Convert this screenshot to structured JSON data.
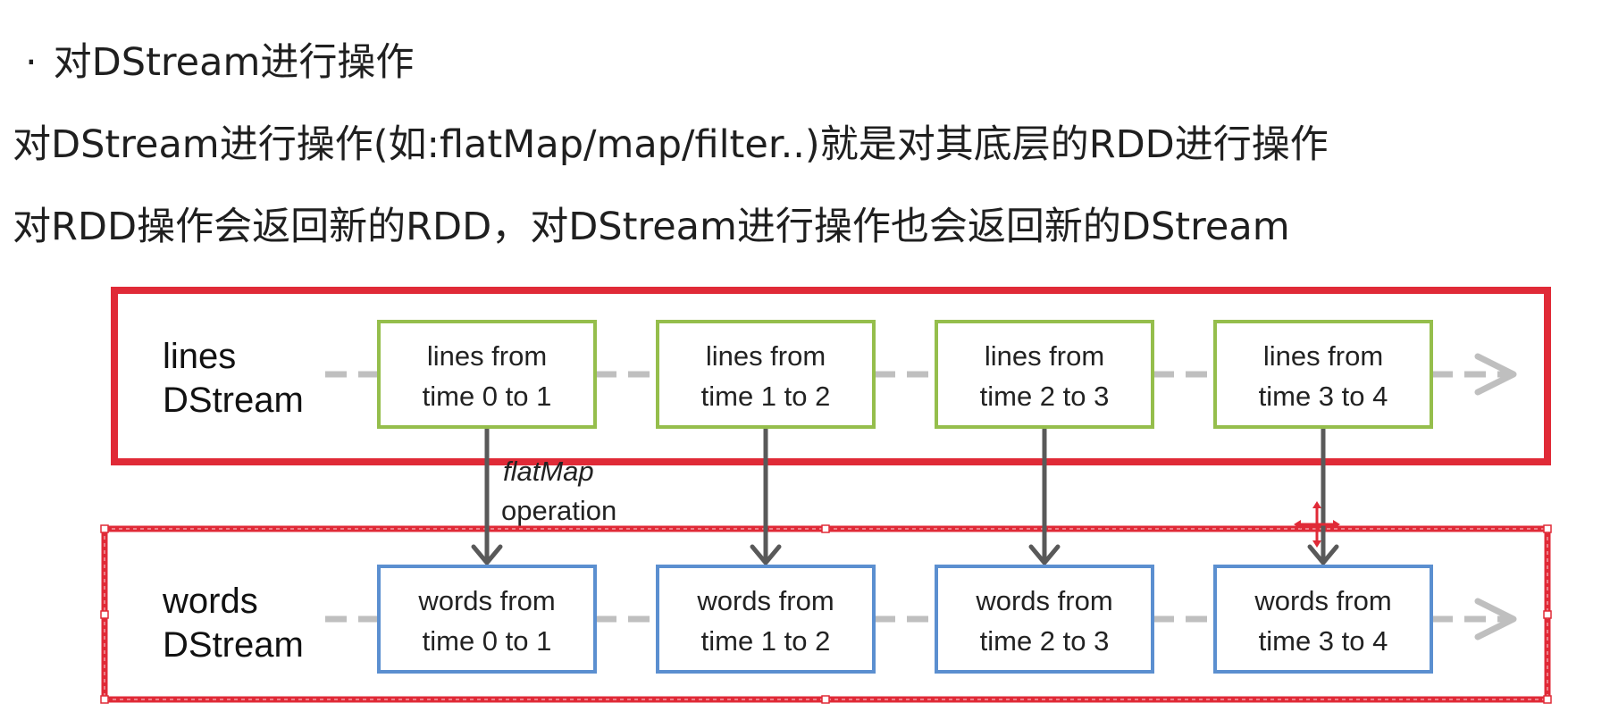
{
  "heading": {
    "bullet": "·",
    "text": "对DStream进行操作"
  },
  "paragraphs": [
    "对DStream进行操作(如:flatMap/map/filter..)就是对其底层的RDD进行操作",
    "对RDD操作会返回新的RDD，对DStream进行操作也会返回新的DStream"
  ],
  "diagram": {
    "colors": {
      "frame": "#e02a37",
      "lines_box": "#95be4c",
      "words_box": "#5b8fd0",
      "dash_arrow": "#bfbfbf",
      "flow_arrow": "#595959"
    },
    "lines_stream": {
      "label_1": "lines",
      "label_2": "DStream",
      "boxes": [
        {
          "line1": "lines from",
          "line2": "time 0 to 1"
        },
        {
          "line1": "lines from",
          "line2": "time 1 to 2"
        },
        {
          "line1": "lines from",
          "line2": "time 2 to 3"
        },
        {
          "line1": "lines from",
          "line2": "time 3 to 4"
        }
      ]
    },
    "words_stream": {
      "label_1": "words",
      "label_2": "DStream",
      "boxes": [
        {
          "line1": "words from",
          "line2": "time 0 to 1"
        },
        {
          "line1": "words from",
          "line2": "time 1 to 2"
        },
        {
          "line1": "words from",
          "line2": "time 2 to 3"
        },
        {
          "line1": "words from",
          "line2": "time 3 to 4"
        }
      ]
    },
    "operation": {
      "name": "flatMap",
      "label": "operation"
    }
  }
}
